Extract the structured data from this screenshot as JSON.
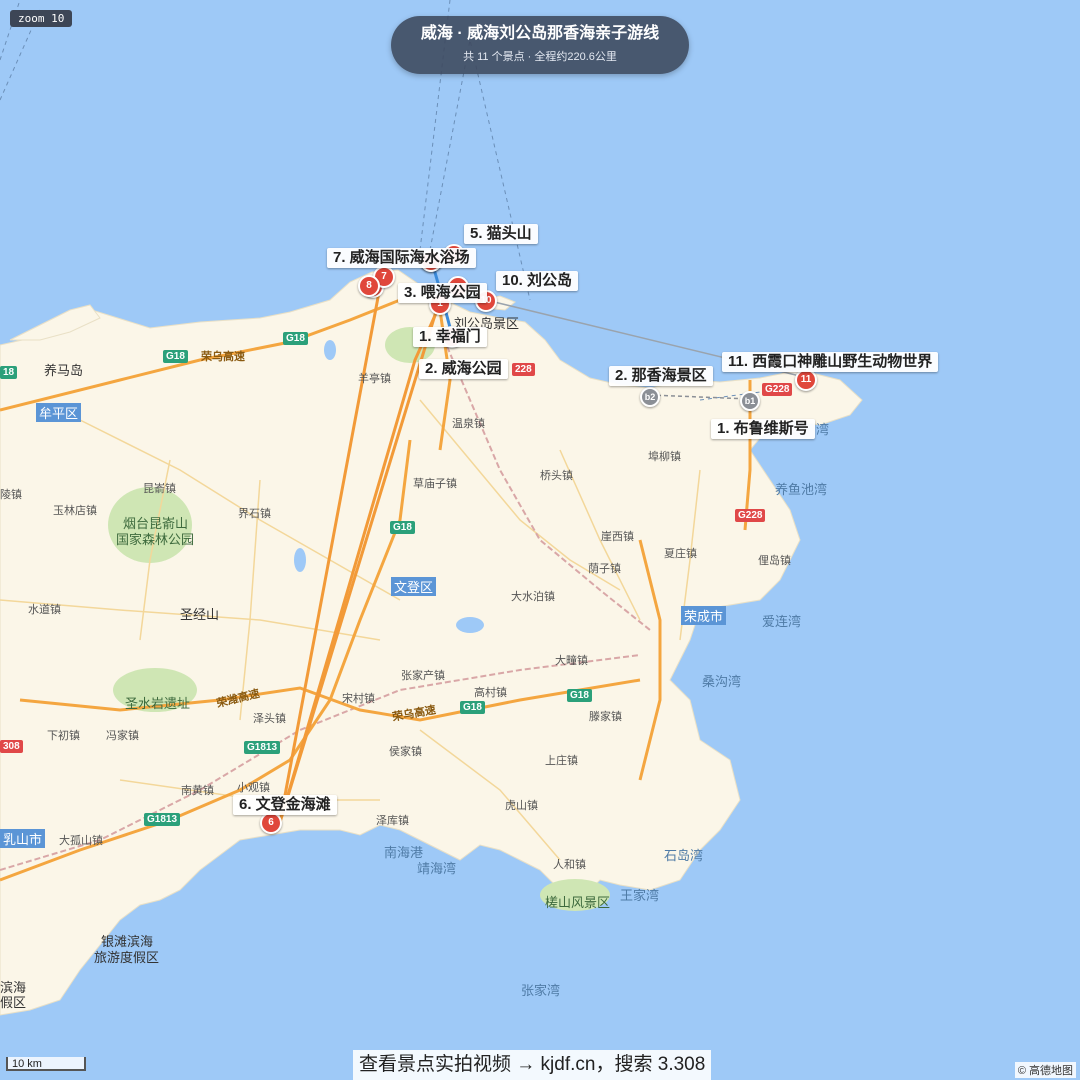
{
  "map": {
    "zoom_label": "zoom 10",
    "title": "威海 · 威海刘公岛那香海亲子游线",
    "subtitle_count": "共 11 个景点",
    "subtitle_sep": " · ",
    "subtitle_distance": "全程约220.6公里",
    "scale_label": "10 km",
    "footer": "查看景点实拍视频 → kjdf.cn，搜索 3.308",
    "attribution": "© 高德地图",
    "colors": {
      "sea": "#9ec9f7",
      "land": "#fbf6e8",
      "route": "#f29a38",
      "pin": "#e0473b",
      "highway": "#f5a623"
    }
  },
  "poi_labels": [
    "5. 猫头山",
    "7. 威海国际海水浴场",
    "10. 刘公岛",
    "3. 喂海公园",
    "1. 幸福门",
    "2. 威海公园",
    "6. 文登金海滩",
    "2. 那香海景区",
    "11. 西霞口神雕山野生动物世界",
    "1. 布鲁维斯号"
  ],
  "pins": [
    "1",
    "2",
    "3",
    "7",
    "8",
    "10",
    "6",
    "11"
  ],
  "gray_pins": [
    "b2",
    "b1"
  ],
  "places": [
    "养马岛",
    "牟平区",
    "羊亭镇",
    "刘公岛景区",
    "温泉镇",
    "桥头镇",
    "埠柳镇",
    "昆嵛镇",
    "玉林店镇",
    "界石镇",
    "烟台昆嵛山",
    "国家森林公园",
    "草庙子镇",
    "崖西镇",
    "夏庄镇",
    "荫子镇",
    "水道镇",
    "圣经山",
    "文登区",
    "大水泊镇",
    "荣成市",
    "爱连湾",
    "养鱼池湾",
    "俚岛镇",
    "桑沟湾",
    "张家产镇",
    "大疃镇",
    "高村镇",
    "宋村镇",
    "泽头镇",
    "圣水岩遗址",
    "滕家镇",
    "下初镇",
    "冯家镇",
    "侯家镇",
    "上庄镇",
    "南黄镇",
    "小观镇",
    "虎山镇",
    "泽库镇",
    "南海港",
    "靖海湾",
    "人和镇",
    "石岛湾",
    "王家湾",
    "槎山风景区",
    "大孤山镇",
    "乳山市",
    "银滩滨海",
    "旅游度假区",
    "张家湾",
    "滨海",
    "假区",
    "陵镇",
    "湾"
  ],
  "highways": [
    "G18",
    "G18",
    "G18",
    "G18",
    "G1813",
    "G1813",
    "G228",
    "G228",
    "308",
    "18",
    "228"
  ],
  "road_names": [
    "荣乌高速",
    "荣潍高速",
    "荣乌高速"
  ]
}
